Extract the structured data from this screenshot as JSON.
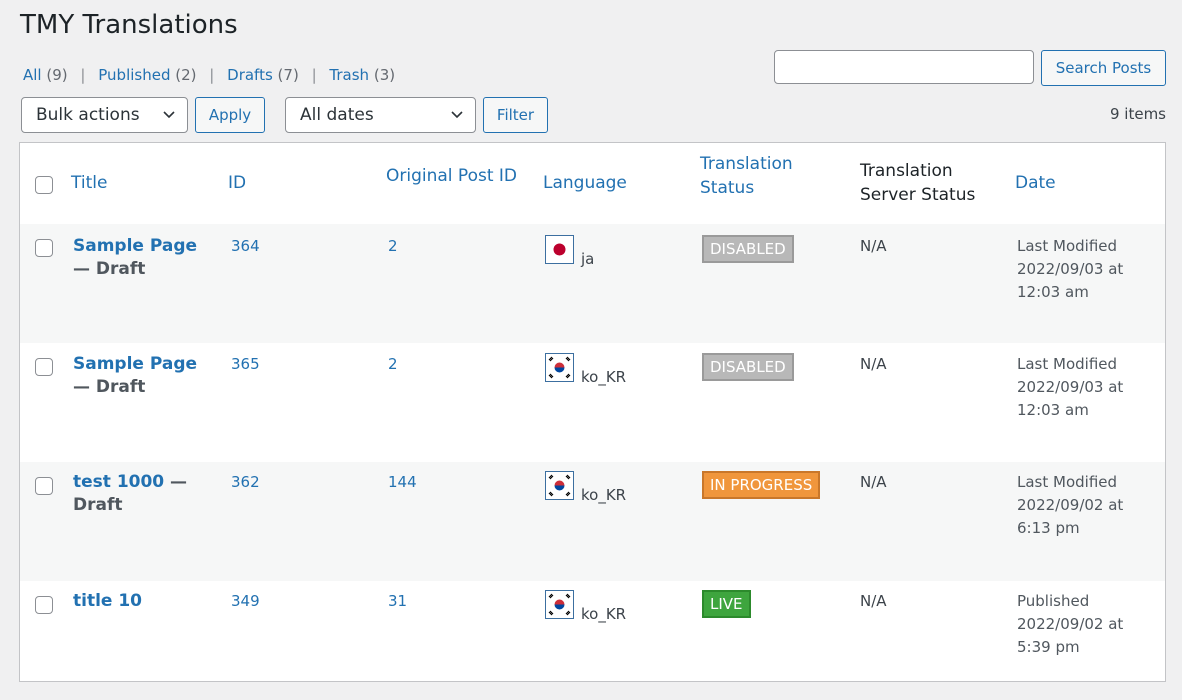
{
  "page": {
    "title": "TMY Translations"
  },
  "views": [
    {
      "label": "All",
      "count": "(9)"
    },
    {
      "label": "Published",
      "count": "(2)"
    },
    {
      "label": "Drafts",
      "count": "(7)"
    },
    {
      "label": "Trash",
      "count": "(3)"
    }
  ],
  "search": {
    "value": "",
    "button": "Search Posts"
  },
  "bulk": {
    "selected": "Bulk actions",
    "apply": "Apply"
  },
  "dates": {
    "selected": "All dates",
    "filter": "Filter"
  },
  "count": "9 items",
  "columns": {
    "title": "Title",
    "id": "ID",
    "original": "Original Post ID",
    "language": "Language",
    "translation_status_1": "Translation",
    "translation_status_2": "Status",
    "server_status_1": "Translation",
    "server_status_2": "Server Status",
    "date": "Date"
  },
  "rows": [
    {
      "title_1": "Sample Page",
      "title_2": "— Draft",
      "id": "364",
      "original": "2",
      "flag": "japan-flag-icon",
      "lang": "ja",
      "status": "DISABLED",
      "server": "N/A",
      "date_1": "Last Modified",
      "date_2": "2022/09/03 at",
      "date_3": "12:03 am"
    },
    {
      "title_1": "Sample Page",
      "title_2": "— Draft",
      "id": "365",
      "original": "2",
      "flag": "korea-flag-icon",
      "lang": "ko_KR",
      "status": "DISABLED",
      "server": "N/A",
      "date_1": "Last Modified",
      "date_2": "2022/09/03 at",
      "date_3": "12:03 am"
    },
    {
      "title_1": "test 1000",
      "title_dash": " —",
      "title_2": "Draft",
      "id": "362",
      "original": "144",
      "flag": "korea-flag-icon",
      "lang": "ko_KR",
      "status": "IN PROGRESS",
      "server": "N/A",
      "date_1": "Last Modified",
      "date_2": "2022/09/02 at",
      "date_3": "6:13 pm"
    },
    {
      "title_1": "title 10",
      "id": "349",
      "original": "31",
      "flag": "korea-flag-icon",
      "lang": "ko_KR",
      "status": "LIVE",
      "server": "N/A",
      "date_1": "Published",
      "date_2": "2022/09/02 at",
      "date_3": "5:39 pm"
    }
  ],
  "colors": {
    "link": "#2271b1",
    "disabled": "#b8b8b8",
    "in_progress": "#f0963c",
    "live": "#3ea53e"
  }
}
